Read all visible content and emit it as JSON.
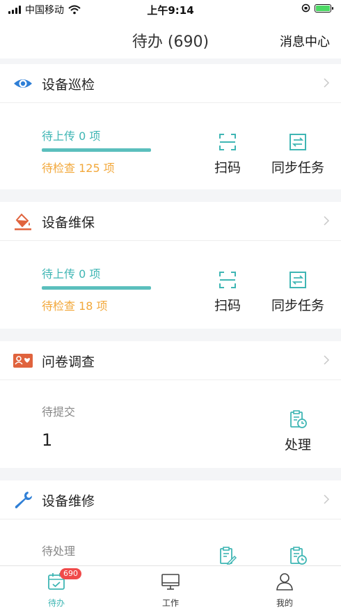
{
  "status_bar": {
    "carrier": "中国移动",
    "time": "上午9:14"
  },
  "nav": {
    "title": "待办 (690)",
    "message_center": "消息中心"
  },
  "inspection": {
    "title": "设备巡检",
    "pending_upload": "待上传 0 项",
    "pending_check": "待检查 125 项",
    "scan": "扫码",
    "sync": "同步任务"
  },
  "maintenance": {
    "title": "设备维保",
    "pending_upload": "待上传 0 项",
    "pending_check": "待检查 18 项",
    "scan": "扫码",
    "sync": "同步任务"
  },
  "survey": {
    "title": "问卷调查",
    "pending_label": "待提交",
    "pending_count": "1",
    "process": "处理"
  },
  "repair": {
    "title": "设备维修",
    "pending_label": "待处理"
  },
  "tabbar": {
    "todo": "待办",
    "todo_badge": "690",
    "work": "工作",
    "mine": "我的"
  },
  "colors": {
    "accent_teal": "#3fb6b4",
    "warning_orange": "#f2a83b",
    "eye_blue": "#2f7fd6",
    "badge_red": "#f04a4a"
  },
  "icons": {
    "inspection": "eye-icon",
    "maintenance": "paint-bucket-icon",
    "survey": "person-heart-icon",
    "repair": "wrench-icon"
  }
}
